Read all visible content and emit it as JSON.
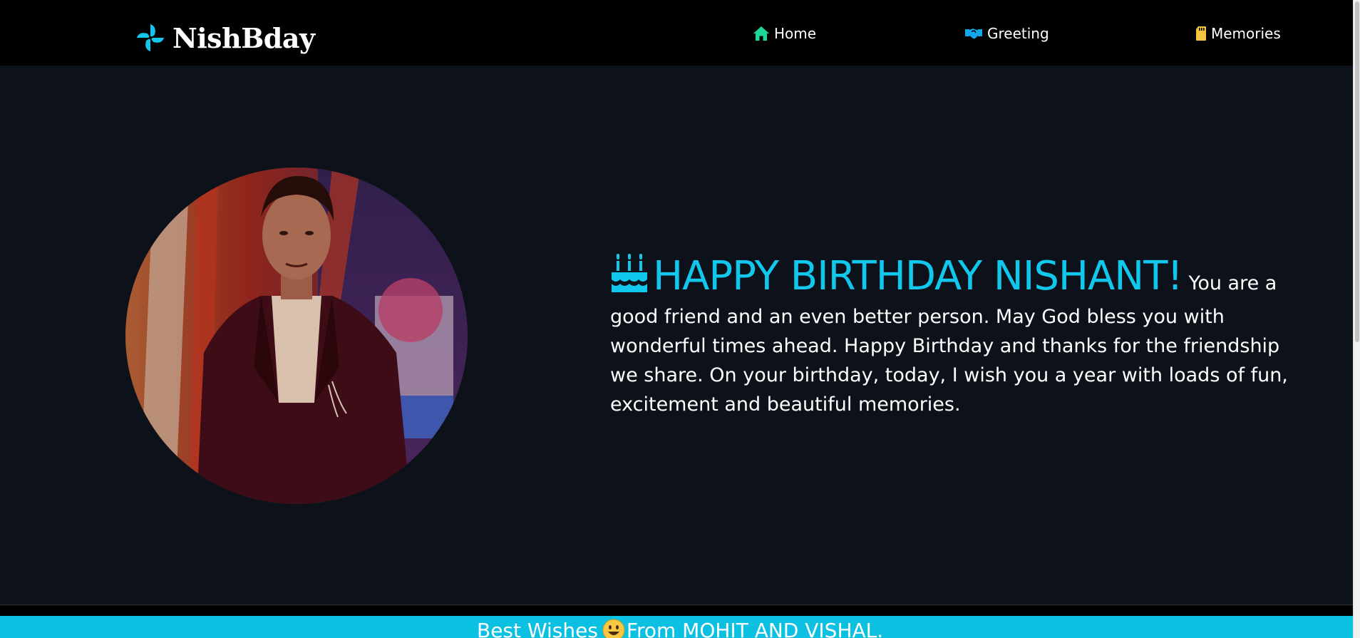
{
  "brand": {
    "name": "NishBday",
    "icon": "pinwheel-icon",
    "color": "#12c7ec"
  },
  "nav": {
    "items": [
      {
        "label": "Home",
        "icon": "home-icon",
        "icon_color": "#1fd69a"
      },
      {
        "label": "Greeting",
        "icon": "handshake-icon",
        "icon_color": "#12a6ec"
      },
      {
        "label": "Memories",
        "icon": "sd-card-icon",
        "icon_color": "#f5c542"
      }
    ]
  },
  "hero": {
    "photo_alt": "portrait-photo",
    "headline": "HAPPY BIRTHDAY NISHANT!",
    "headline_icon": "birthday-cake-icon",
    "message": "You are a good friend and an even better person. May God bless you with wonderful times ahead. Happy Birthday and thanks for the friendship we share. On your birthday, today, I wish you a year with loads of fun, excitement and beautiful memories."
  },
  "footer": {
    "text_before": "Best Wishes",
    "emoji": "smiley-face-icon",
    "text_after": "From MOHIT AND VISHAL."
  },
  "colors": {
    "accent": "#12c7ec",
    "background": "#0d111a",
    "navbar": "#000000",
    "footer": "#0bc0e0"
  }
}
